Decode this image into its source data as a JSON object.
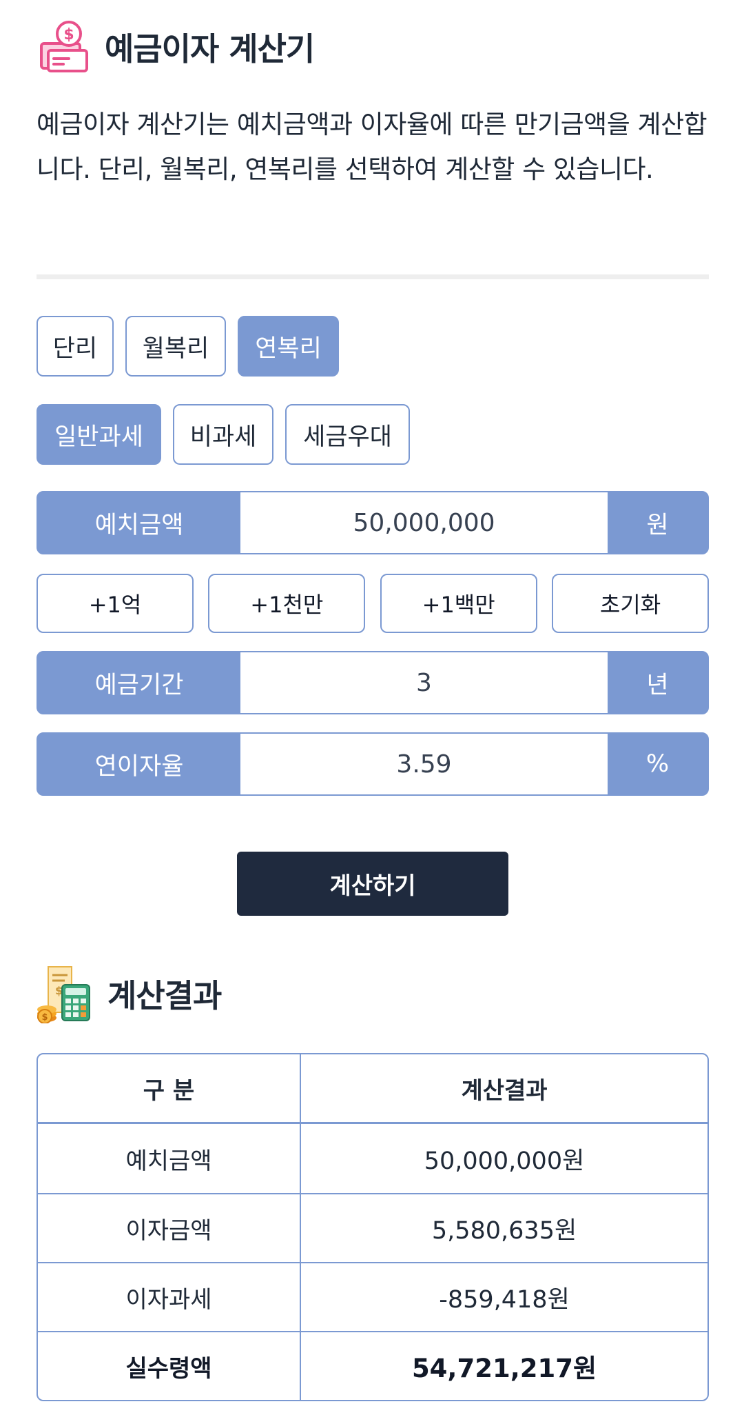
{
  "header": {
    "title": "예금이자 계산기",
    "icon": "money-bill-icon"
  },
  "description": "예금이자 계산기는 예치금액과 이자율에 따른 만기금액을 계산합니다. 단리, 월복리, 연복리를 선택하여 계산할 수 있습니다.",
  "interest_types": [
    {
      "label": "단리",
      "active": false
    },
    {
      "label": "월복리",
      "active": false
    },
    {
      "label": "연복리",
      "active": true
    }
  ],
  "tax_types": [
    {
      "label": "일반과세",
      "active": true
    },
    {
      "label": "비과세",
      "active": false
    },
    {
      "label": "세금우대",
      "active": false
    }
  ],
  "deposit": {
    "label": "예치금액",
    "value": "50,000,000",
    "unit": "원"
  },
  "quick_buttons": [
    "+1억",
    "+1천만",
    "+1백만",
    "초기화"
  ],
  "period": {
    "label": "예금기간",
    "value": "3",
    "unit": "년"
  },
  "rate": {
    "label": "연이자율",
    "value": "3.59",
    "unit": "%"
  },
  "calculate_button": "계산하기",
  "result": {
    "title": "계산결과",
    "icon": "calculator-receipt-icon",
    "columns": [
      "구 분",
      "계산결과"
    ],
    "rows": [
      {
        "label": "예치금액",
        "value": "50,000,000원"
      },
      {
        "label": "이자금액",
        "value": "5,580,635원"
      },
      {
        "label": "이자과세",
        "value": "-859,418원"
      },
      {
        "label": "실수령액",
        "value": "54,721,217원"
      }
    ]
  },
  "colors": {
    "accent": "#7b99d2",
    "button_dark": "#1f2a3e",
    "icon_pink": "#e8508a"
  }
}
